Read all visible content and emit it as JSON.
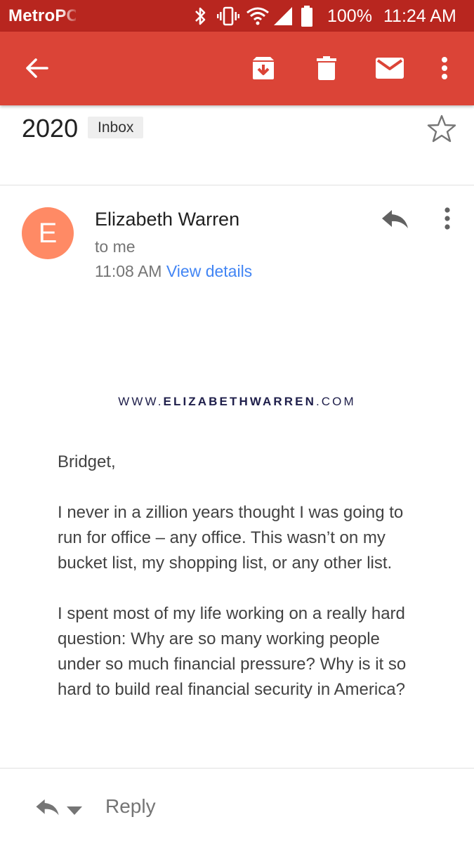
{
  "status_bar": {
    "carrier": "MetroPCS",
    "battery": "100%",
    "time": "11:24 AM",
    "icons": [
      "bluetooth-icon",
      "vibrate-icon",
      "wifi-icon",
      "signal-icon",
      "battery-icon"
    ]
  },
  "toolbar": {
    "back_icon": "arrow-left-icon",
    "archive_icon": "archive-icon",
    "delete_icon": "trash-icon",
    "mark_unread_icon": "mail-icon",
    "more_icon": "more-vert-icon",
    "color": "#db4437"
  },
  "email": {
    "subject": "2020",
    "label": "Inbox",
    "sender": {
      "initial": "E",
      "name": "Elizabeth Warren",
      "recipient": "to me",
      "time": "11:08 AM",
      "view_details": "View details",
      "avatar_color": "#ff8a65"
    },
    "header_site": {
      "prefix": "WWW.",
      "domain": "ELIZABETHWARREN",
      "suffix": ".COM"
    },
    "body": [
      "Bridget,",
      "I never in a zillion years thought I was going to run for office – any office. This wasn’t on my bucket list, my shopping list, or any other list.",
      "I spent most of my life working on a really hard question: Why are so many working people under so much financial pressure? Why is it so hard to build real financial security in America?"
    ]
  },
  "footer": {
    "reply_label": "Reply"
  }
}
